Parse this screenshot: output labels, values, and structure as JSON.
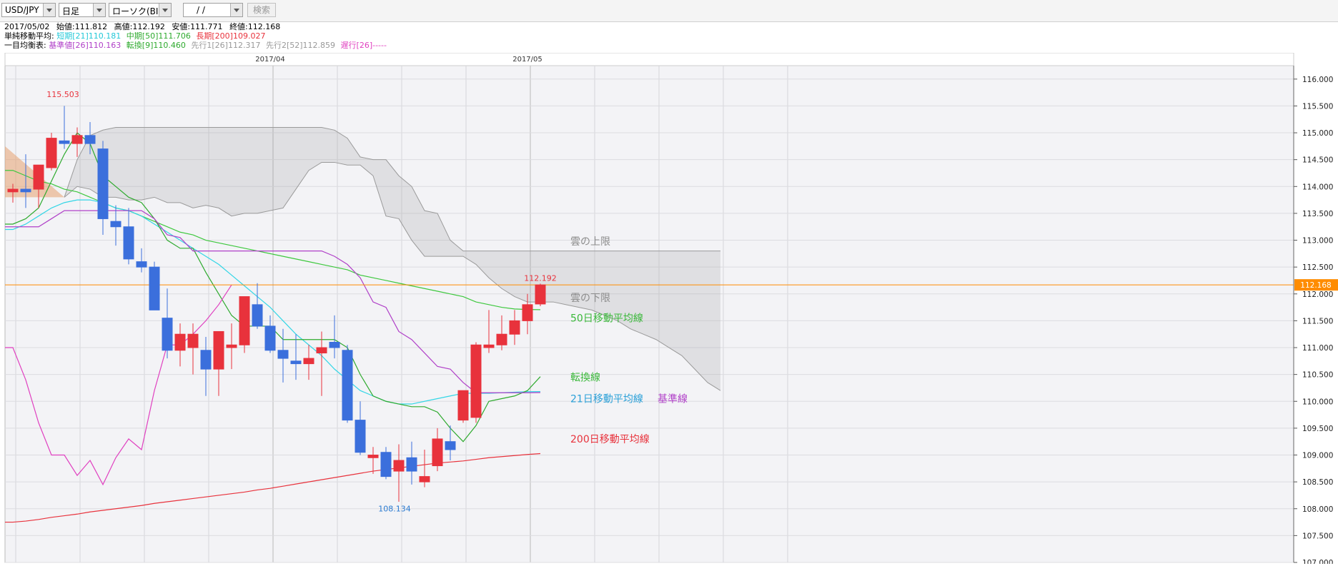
{
  "toolbar": {
    "symbol": "USD/JPY",
    "period": "日足",
    "chart_type": "ローソク(BID)",
    "date_input": " /  /",
    "search_label": "検索"
  },
  "info": {
    "ohlc": {
      "date": "2017/05/02",
      "open_label": "始値:",
      "open": "111.812",
      "high_label": "高値:",
      "high": "112.192",
      "low_label": "安値:",
      "low": "111.771",
      "close_label": "終値:",
      "close": "112.168"
    },
    "sma": {
      "label": "単純移動平均:",
      "short": "短期[21]110.181",
      "mid": "中期[50]111.706",
      "long": "長期[200]109.027"
    },
    "ichimoku": {
      "label": "一目均衡表:",
      "kijun": "基準値[26]110.163",
      "tenkan": "転換[9]110.460",
      "span1": "先行1[26]112.317",
      "span2": "先行2[52]112.859",
      "chikou": "遅行[26]-----"
    }
  },
  "colors": {
    "bull": "#e8323c",
    "bear": "#3b6fdc",
    "sma21": "#33d6e6",
    "sma50": "#3ec83e",
    "sma200": "#e8323c",
    "tenkan": "#2eaa2e",
    "kijun": "#b040c8",
    "chikou": "#e040c0",
    "cloud": "#9a9a9a",
    "current": "#ff8c00",
    "plot_bg": "#f3f3f6"
  },
  "chart_data": {
    "type": "candlestick",
    "symbol": "USD/JPY",
    "timeframe": "daily",
    "y_axis": {
      "min": 107.0,
      "max": 116.25,
      "ticks": [
        "116.000",
        "115.500",
        "115.000",
        "114.500",
        "114.000",
        "113.500",
        "113.000",
        "112.500",
        "112.000",
        "111.500",
        "111.000",
        "110.500",
        "110.000",
        "109.500",
        "109.000",
        "108.500",
        "108.000",
        "107.500",
        "107.000"
      ]
    },
    "x_month_labels": [
      {
        "label": "2017/04",
        "index": 20
      },
      {
        "label": "2017/05",
        "index": 40
      }
    ],
    "current_price": {
      "value": 112.168,
      "label": "112.168"
    },
    "annotations": {
      "high": {
        "value": 115.503,
        "label": "115.503",
        "index": 4
      },
      "low": {
        "value": 108.134,
        "label": "108.134",
        "index": 30
      },
      "last_high": {
        "value": 112.192,
        "label": "112.192",
        "index": 41
      }
    },
    "candles": [
      [
        113.9,
        114.05,
        113.7,
        113.95
      ],
      [
        113.95,
        114.6,
        113.6,
        113.9
      ],
      [
        113.95,
        114.35,
        113.6,
        114.4
      ],
      [
        114.35,
        115.0,
        114.3,
        114.9
      ],
      [
        114.85,
        115.5,
        114.7,
        114.8
      ],
      [
        114.8,
        115.1,
        114.55,
        114.95
      ],
      [
        114.95,
        115.2,
        114.6,
        114.8
      ],
      [
        114.7,
        114.85,
        113.1,
        113.4
      ],
      [
        113.35,
        113.65,
        112.9,
        113.25
      ],
      [
        113.25,
        113.6,
        112.55,
        112.65
      ],
      [
        112.6,
        112.85,
        112.4,
        112.5
      ],
      [
        112.5,
        112.6,
        111.7,
        111.7
      ],
      [
        111.55,
        112.1,
        110.8,
        110.95
      ],
      [
        110.95,
        111.45,
        110.65,
        111.25
      ],
      [
        111.0,
        111.45,
        110.5,
        111.25
      ],
      [
        110.95,
        111.2,
        110.1,
        110.6
      ],
      [
        110.6,
        111.25,
        110.1,
        111.3
      ],
      [
        111.0,
        111.45,
        110.6,
        111.05
      ],
      [
        111.05,
        111.95,
        110.9,
        111.95
      ],
      [
        111.8,
        112.2,
        111.35,
        111.4
      ],
      [
        111.4,
        111.6,
        110.9,
        110.95
      ],
      [
        110.95,
        111.35,
        110.35,
        110.8
      ],
      [
        110.75,
        111.25,
        110.4,
        110.7
      ],
      [
        110.7,
        111.05,
        110.4,
        110.8
      ],
      [
        110.9,
        111.3,
        110.1,
        111.0
      ],
      [
        111.1,
        111.6,
        110.8,
        111.0
      ],
      [
        110.95,
        111.05,
        109.6,
        109.65
      ],
      [
        109.65,
        110.0,
        109.0,
        109.05
      ],
      [
        108.95,
        109.15,
        108.65,
        109.0
      ],
      [
        109.05,
        109.15,
        108.55,
        108.6
      ],
      [
        108.7,
        109.2,
        108.13,
        108.9
      ],
      [
        108.95,
        109.25,
        108.45,
        108.7
      ],
      [
        108.5,
        109.1,
        108.4,
        108.6
      ],
      [
        108.8,
        109.5,
        108.7,
        109.3
      ],
      [
        109.25,
        109.55,
        108.9,
        109.1
      ],
      [
        109.65,
        110.2,
        109.6,
        110.2
      ],
      [
        109.7,
        111.1,
        109.6,
        111.05
      ],
      [
        111.0,
        111.7,
        110.9,
        111.05
      ],
      [
        111.05,
        111.6,
        110.95,
        111.25
      ],
      [
        111.25,
        111.7,
        111.05,
        111.5
      ],
      [
        111.5,
        112.0,
        111.25,
        111.8
      ],
      [
        111.812,
        112.192,
        111.771,
        112.168
      ]
    ],
    "sma21": [
      113.2,
      113.3,
      113.45,
      113.6,
      113.7,
      113.75,
      113.75,
      113.7,
      113.6,
      113.55,
      113.45,
      113.3,
      113.15,
      113.0,
      112.85,
      112.7,
      112.55,
      112.35,
      112.15,
      111.95,
      111.75,
      111.5,
      111.25,
      111.05,
      110.85,
      110.6,
      110.4,
      110.2,
      110.1,
      110.0,
      109.95,
      109.95,
      110.0,
      110.05,
      110.1,
      110.15,
      110.15,
      110.15,
      110.16,
      110.17,
      110.18,
      110.181
    ],
    "sma50": [
      114.3,
      114.2,
      114.1,
      114.05,
      113.95,
      113.9,
      113.8,
      113.7,
      113.6,
      113.55,
      113.45,
      113.35,
      113.25,
      113.15,
      113.1,
      113.0,
      112.95,
      112.9,
      112.85,
      112.8,
      112.75,
      112.7,
      112.65,
      112.6,
      112.55,
      112.5,
      112.45,
      112.35,
      112.3,
      112.25,
      112.2,
      112.15,
      112.1,
      112.05,
      112.0,
      111.95,
      111.85,
      111.8,
      111.75,
      111.72,
      111.71,
      111.706
    ],
    "sma200": [
      107.75,
      107.77,
      107.8,
      107.84,
      107.87,
      107.9,
      107.94,
      107.97,
      108.0,
      108.03,
      108.06,
      108.1,
      108.13,
      108.16,
      108.19,
      108.22,
      108.25,
      108.28,
      108.31,
      108.35,
      108.38,
      108.42,
      108.46,
      108.5,
      108.54,
      108.58,
      108.62,
      108.66,
      108.7,
      108.73,
      108.76,
      108.79,
      108.82,
      108.85,
      108.87,
      108.89,
      108.92,
      108.95,
      108.97,
      108.99,
      109.01,
      109.027
    ],
    "tenkan": [
      113.3,
      113.4,
      113.6,
      114.1,
      114.6,
      115.0,
      114.8,
      114.2,
      114.0,
      113.8,
      113.7,
      113.4,
      113.0,
      112.85,
      112.85,
      112.4,
      112.0,
      111.6,
      111.4,
      111.4,
      111.4,
      111.15,
      111.15,
      111.15,
      111.15,
      111.15,
      111.0,
      110.5,
      110.1,
      110.0,
      109.95,
      109.9,
      109.9,
      109.8,
      109.5,
      109.25,
      109.55,
      110.0,
      110.05,
      110.1,
      110.2,
      110.46
    ],
    "kijun": [
      113.25,
      113.25,
      113.25,
      113.4,
      113.55,
      113.55,
      113.55,
      113.55,
      113.55,
      113.55,
      113.55,
      113.4,
      113.1,
      113.05,
      112.8,
      112.8,
      112.8,
      112.8,
      112.8,
      112.8,
      112.8,
      112.8,
      112.8,
      112.8,
      112.8,
      112.7,
      112.55,
      112.3,
      111.85,
      111.75,
      111.3,
      111.15,
      110.9,
      110.65,
      110.6,
      110.35,
      110.16,
      110.16,
      110.16,
      110.16,
      110.16,
      110.163
    ],
    "chikou": [
      111.0,
      110.4,
      109.6,
      109.0,
      109.0,
      108.62,
      108.9,
      108.45,
      108.95,
      109.3,
      109.1,
      110.2,
      111.05,
      111.05,
      111.25,
      111.5,
      111.8,
      112.168
    ],
    "span_a": [
      null,
      null,
      null,
      null,
      113.8,
      114.0,
      113.95,
      113.8,
      113.8,
      113.75,
      113.75,
      113.8,
      113.7,
      113.7,
      113.6,
      113.65,
      113.6,
      113.45,
      113.5,
      113.5,
      113.55,
      113.6,
      113.95,
      114.3,
      114.45,
      114.45,
      114.4,
      114.4,
      114.2,
      113.45,
      113.4,
      113.0,
      112.7,
      112.7,
      112.7,
      112.7,
      112.55,
      112.3,
      112.1,
      111.95,
      111.85,
      111.85,
      111.85,
      111.8,
      111.75,
      111.7,
      111.6,
      111.5,
      111.35,
      111.25,
      111.15,
      111.0,
      110.85,
      110.6,
      110.35,
      110.2
    ],
    "span_b": [
      null,
      null,
      null,
      null,
      113.8,
      114.5,
      114.95,
      115.05,
      115.1,
      115.1,
      115.1,
      115.1,
      115.1,
      115.1,
      115.1,
      115.1,
      115.1,
      115.1,
      115.1,
      115.1,
      115.1,
      115.1,
      115.1,
      115.1,
      115.1,
      115.05,
      114.9,
      114.55,
      114.5,
      114.5,
      114.2,
      114.0,
      113.55,
      113.5,
      113.0,
      112.8,
      112.8,
      112.8,
      112.8,
      112.8,
      112.8,
      112.8,
      112.8,
      112.8,
      112.8,
      112.8,
      112.8,
      112.8,
      112.8,
      112.8,
      112.8,
      112.8,
      112.8,
      112.8,
      112.8,
      112.8
    ],
    "legend_labels": [
      {
        "key": "cloud_upper",
        "text": "雲の上限",
        "value": 112.98,
        "color": "#8c8c8c"
      },
      {
        "key": "cloud_lower",
        "text": "雲の下限",
        "value": 111.93,
        "color": "#8c8c8c"
      },
      {
        "key": "sma50",
        "text": "50日移動平均線",
        "value": 111.55,
        "color": "#3ab83a"
      },
      {
        "key": "tenkan",
        "text": "転換線",
        "value": 110.45,
        "color": "#3ab83a"
      },
      {
        "key": "sma21",
        "text": "21日移動平均線",
        "value": 110.05,
        "color": "#2aa0d8"
      },
      {
        "key": "kijun",
        "text": "基準線",
        "value": 110.05,
        "color": "#b040c8"
      },
      {
        "key": "sma200",
        "text": "200日移動平均線",
        "value": 109.3,
        "color": "#e8323c"
      }
    ]
  }
}
